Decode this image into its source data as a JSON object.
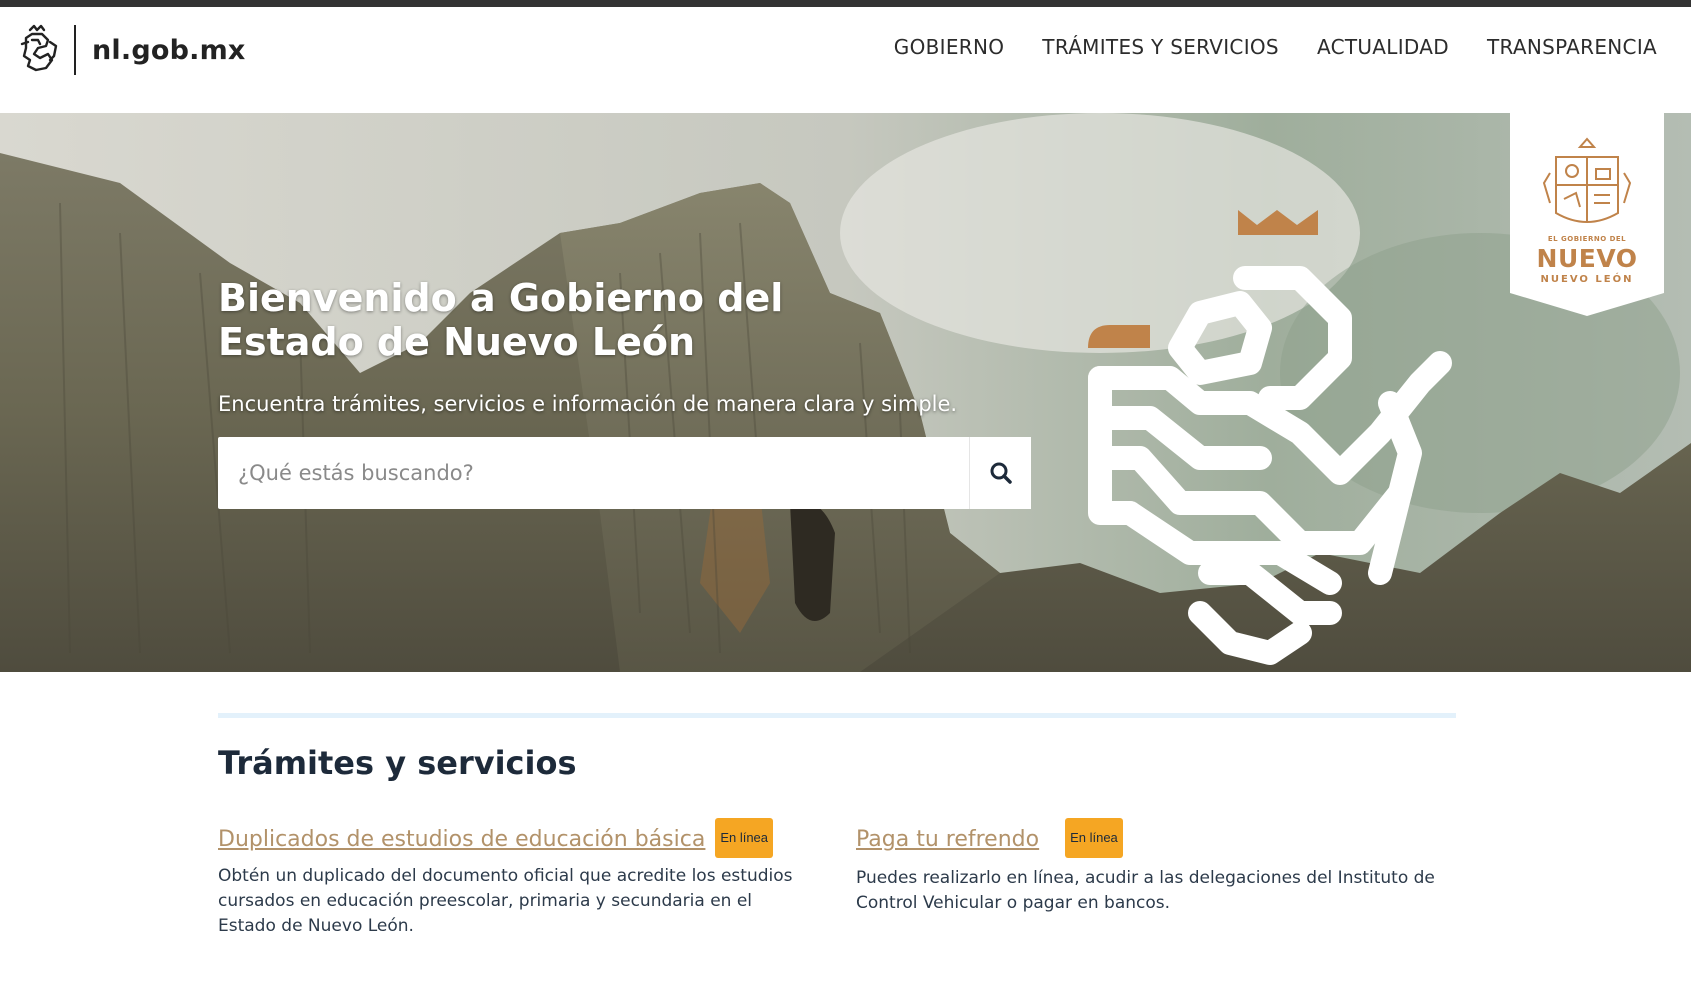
{
  "header": {
    "site_name": "nl.gob.mx",
    "nav": [
      "GOBIERNO",
      "TRÁMITES Y SERVICIOS",
      "ACTUALIDAD",
      "TRANSPARENCIA"
    ]
  },
  "hero": {
    "title": "Bienvenido a Gobierno del Estado de Nuevo León",
    "subtitle": "Encuentra trámites, servicios e información de manera clara y simple.",
    "search_placeholder": "¿Qué estás buscando?"
  },
  "emblem": {
    "line1": "EL GOBIERNO DEL",
    "line2": "NUEVO",
    "line3": "NUEVO LEÓN"
  },
  "services": {
    "title": "Trámites y servicios",
    "items": [
      {
        "title": "Duplicados de estudios de educación básica",
        "badge": "En línea",
        "description": "Obtén un duplicado del documento oficial que acredite los estudios cursados en educación preescolar, primaria y secundaria en el Estado de Nuevo León."
      },
      {
        "title": "Paga tu refrendo",
        "badge": "En línea",
        "description": "Puedes realizarlo en línea, acudir a las delegaciones del Instituto de Control Vehicular o pagar en bancos."
      }
    ]
  },
  "colors": {
    "accent_link": "#b2926a",
    "badge": "#f5a623",
    "emblem_copper": "#c0834a",
    "text_dark": "#1d2a3a"
  },
  "icons": [
    "lion-logo-icon",
    "search-icon",
    "coat-of-arms-icon",
    "lion-graphic-icon"
  ]
}
